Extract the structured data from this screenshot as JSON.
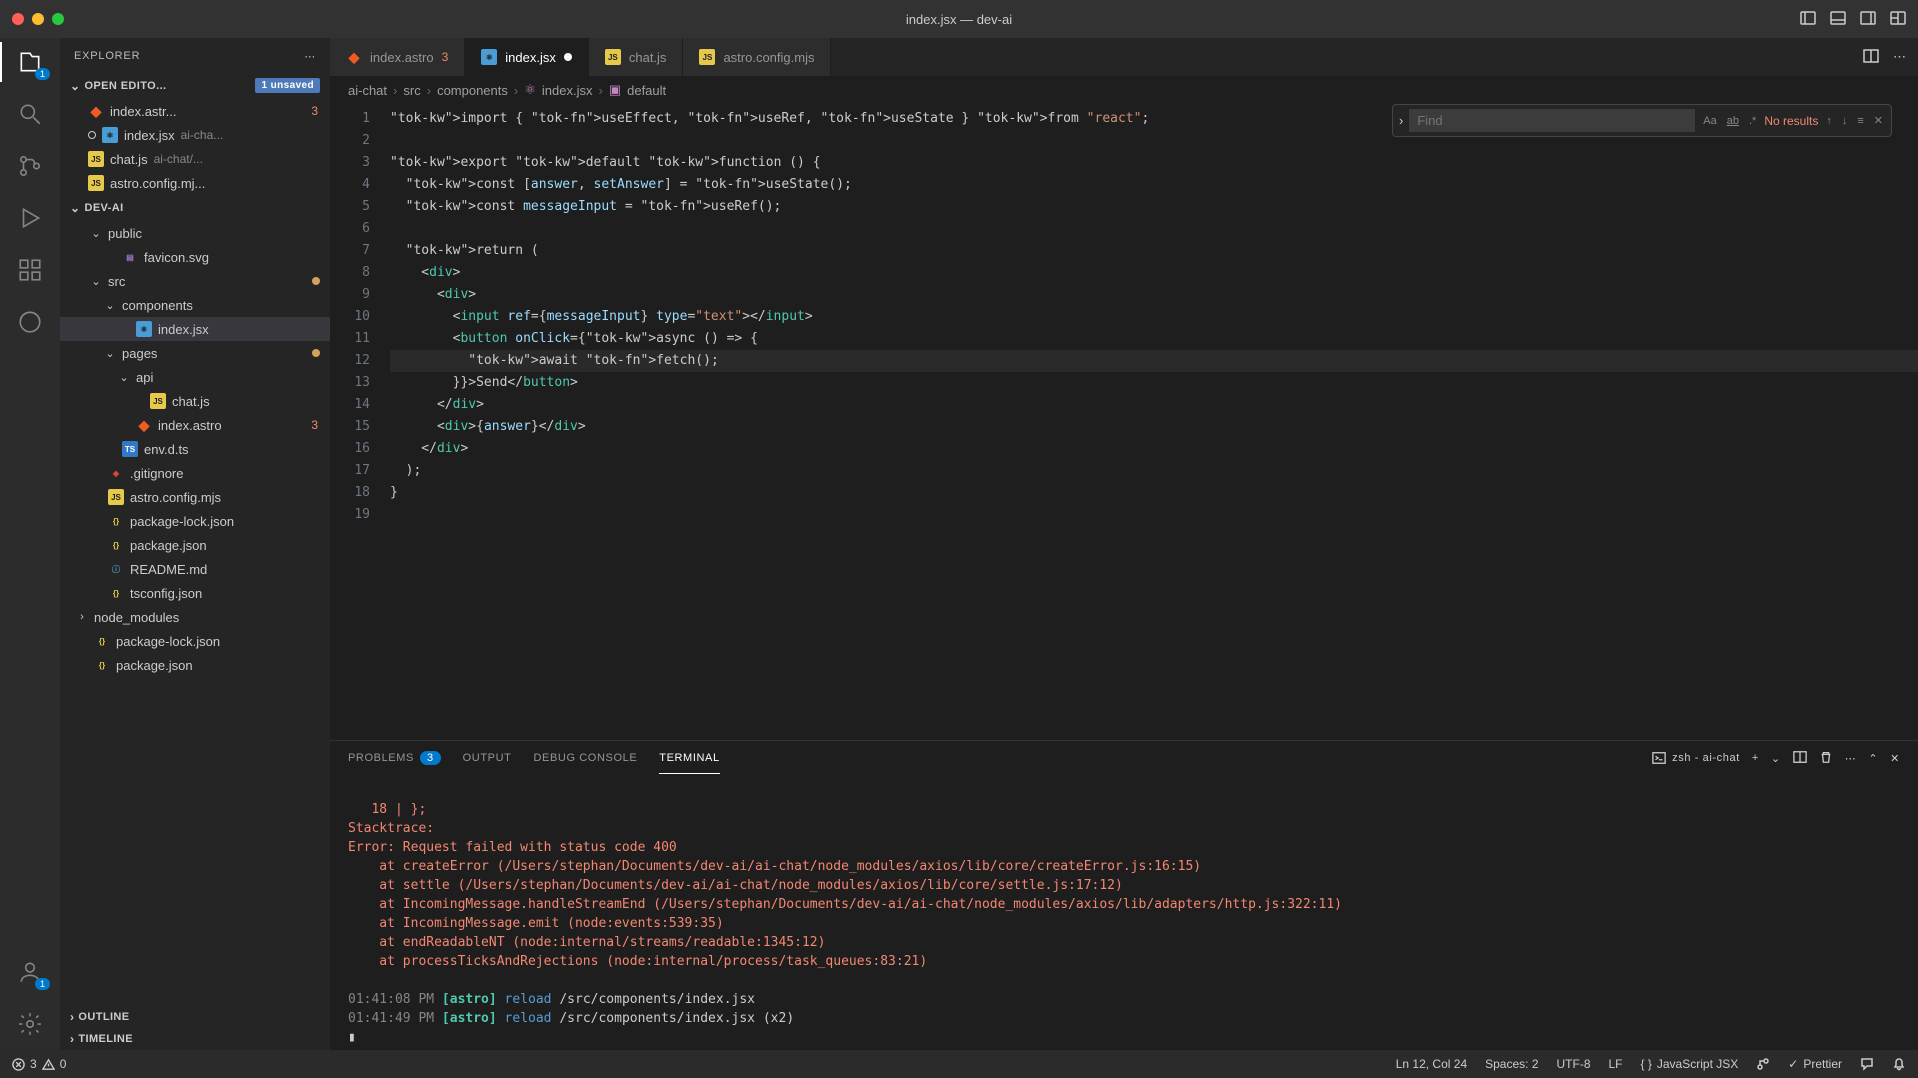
{
  "window_title": "index.jsx — dev-ai",
  "explorer_label": "EXPLORER",
  "open_editors": {
    "label": "OPEN EDITO...",
    "unsaved_badge": "1\nunsaved",
    "items": [
      {
        "name": "index.astr...",
        "icon": "astro",
        "errors": "3"
      },
      {
        "name": "index.jsx",
        "dim": "ai-cha...",
        "icon": "jsx",
        "unsaved": true
      },
      {
        "name": "chat.js",
        "dim": "ai-chat/...",
        "icon": "js"
      },
      {
        "name": "astro.config.mj...",
        "icon": "js"
      }
    ]
  },
  "project": {
    "name": "DEV-AI",
    "tree": [
      {
        "d": 1,
        "name": "public",
        "kind": "folder",
        "open": true
      },
      {
        "d": 2,
        "name": "favicon.svg",
        "icon": "svg"
      },
      {
        "d": 1,
        "name": "src",
        "kind": "folder",
        "open": true,
        "modified": true
      },
      {
        "d": 2,
        "name": "components",
        "kind": "folder",
        "open": true
      },
      {
        "d": 3,
        "name": "index.jsx",
        "icon": "jsx",
        "active": true
      },
      {
        "d": 2,
        "name": "pages",
        "kind": "folder",
        "open": true,
        "modified": true
      },
      {
        "d": 3,
        "name": "api",
        "kind": "folder",
        "open": true
      },
      {
        "d": 4,
        "name": "chat.js",
        "icon": "js"
      },
      {
        "d": 3,
        "name": "index.astro",
        "icon": "astro",
        "errors": "3"
      },
      {
        "d": 2,
        "name": "env.d.ts",
        "icon": "ts"
      },
      {
        "d": 1,
        "name": ".gitignore",
        "icon": "git"
      },
      {
        "d": 1,
        "name": "astro.config.mjs",
        "icon": "js"
      },
      {
        "d": 1,
        "name": "package-lock.json",
        "icon": "json"
      },
      {
        "d": 1,
        "name": "package.json",
        "icon": "json"
      },
      {
        "d": 1,
        "name": "README.md",
        "icon": "md"
      },
      {
        "d": 1,
        "name": "tsconfig.json",
        "icon": "json"
      },
      {
        "d": 0,
        "name": "node_modules",
        "kind": "folder"
      },
      {
        "d": 0,
        "name": "package-lock.json",
        "icon": "json"
      },
      {
        "d": 0,
        "name": "package.json",
        "icon": "json"
      }
    ]
  },
  "outline_label": "OUTLINE",
  "timeline_label": "TIMELINE",
  "tabs": [
    {
      "label": "index.astro",
      "icon": "astro",
      "errors": "3"
    },
    {
      "label": "index.jsx",
      "icon": "jsx",
      "active": true,
      "dirty": true
    },
    {
      "label": "chat.js",
      "icon": "js"
    },
    {
      "label": "astro.config.mjs",
      "icon": "js"
    }
  ],
  "breadcrumbs": [
    "ai-chat",
    "src",
    "components",
    "index.jsx",
    "default"
  ],
  "find": {
    "placeholder": "Find",
    "value": "",
    "result": "No results"
  },
  "code_lines": [
    "import { useEffect, useRef, useState } from \"react\";",
    "",
    "export default function () {",
    "  const [answer, setAnswer] = useState();",
    "  const messageInput = useRef();",
    "",
    "  return (",
    "    <div>",
    "      <div>",
    "        <input ref={messageInput} type=\"text\"></input>",
    "        <button onClick={async () => {",
    "          await fetch();",
    "        }}>Send</button>",
    "      </div>",
    "      <div>{answer}</div>",
    "    </div>",
    "  );",
    "}",
    ""
  ],
  "panel": {
    "tabs": {
      "problems": "PROBLEMS",
      "problems_count": "3",
      "output": "OUTPUT",
      "debug": "DEBUG CONSOLE",
      "terminal": "TERMINAL"
    },
    "shell": "zsh - ai-chat",
    "terminal_text": "   18 | };\nStacktrace:\nError: Request failed with status code 400\n    at createError (/Users/stephan/Documents/dev-ai/ai-chat/node_modules/axios/lib/core/createError.js:16:15)\n    at settle (/Users/stephan/Documents/dev-ai/ai-chat/node_modules/axios/lib/core/settle.js:17:12)\n    at IncomingMessage.handleStreamEnd (/Users/stephan/Documents/dev-ai/ai-chat/node_modules/axios/lib/adapters/http.js:322:11)\n    at IncomingMessage.emit (node:events:539:35)\n    at endReadableNT (node:internal/streams/readable:1345:12)\n    at processTicksAndRejections (node:internal/process/task_queues:83:21)",
    "reload1_time": "01:41:08 PM",
    "reload1_tag": "[astro]",
    "reload_word": "reload",
    "reload1_path": "/src/components/index.jsx",
    "reload2_time": "01:41:49 PM",
    "reload2_path": "/src/components/index.jsx (x2)"
  },
  "status": {
    "errors": "3",
    "warnings": "0",
    "cursor": "Ln 12, Col 24",
    "spaces": "Spaces: 2",
    "encoding": "UTF-8",
    "eol": "LF",
    "lang": "JavaScript JSX",
    "prettier": "Prettier"
  },
  "activity_badge": "1"
}
